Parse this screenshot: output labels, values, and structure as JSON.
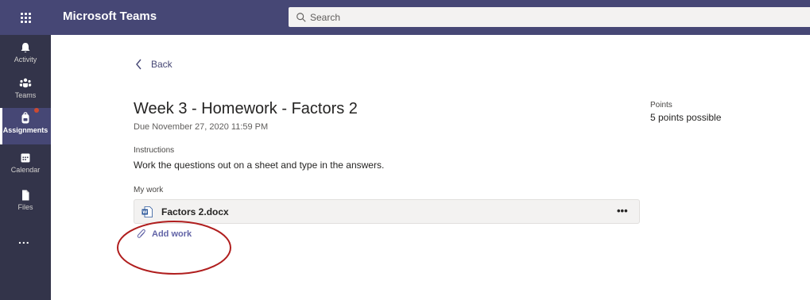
{
  "header": {
    "app_title": "Microsoft Teams",
    "search_placeholder": "Search",
    "apps_icon": "waffle-grid-icon"
  },
  "rail": {
    "items": [
      {
        "label": "Activity",
        "icon": "bell-icon"
      },
      {
        "label": "Teams",
        "icon": "teams-people-icon"
      },
      {
        "label": "Assignments",
        "icon": "backpack-icon",
        "active": true,
        "has_notification": true
      },
      {
        "label": "Calendar",
        "icon": "calendar-icon"
      },
      {
        "label": "Files",
        "icon": "file-icon"
      }
    ],
    "more_label": "..."
  },
  "assignment": {
    "back_label": "Back",
    "title": "Week 3 - Homework - Factors 2",
    "due": "Due November 27, 2020 11:59 PM",
    "instructions_label": "Instructions",
    "instructions_text": "Work the questions out on a sheet and type in the answers.",
    "my_work_label": "My work",
    "files": [
      {
        "name": "Factors 2.docx",
        "icon": "word-document-icon",
        "more": "•••"
      }
    ],
    "add_work_label": "Add work",
    "points_label": "Points",
    "points_value": "5 points possible"
  },
  "colors": {
    "header_bg": "#464775",
    "rail_bg": "#33344a",
    "accent": "#6264a7",
    "notification": "#cc4a31",
    "annotation_circle": "#b01e1e"
  }
}
